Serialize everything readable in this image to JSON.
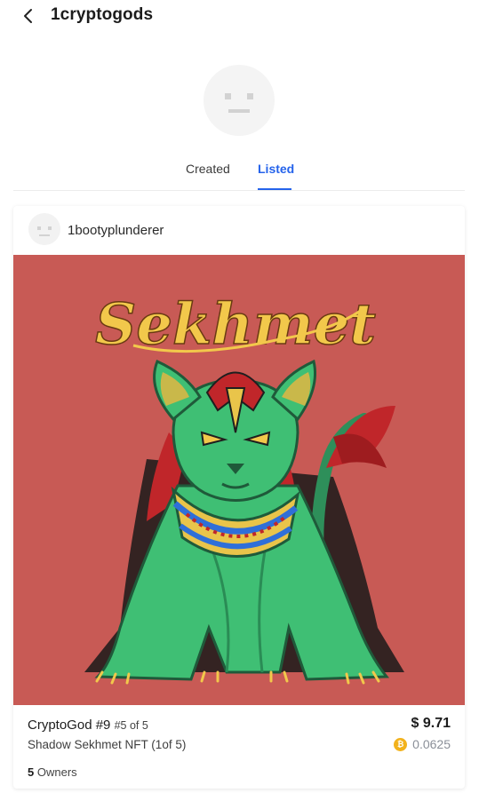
{
  "header": {
    "title": "1cryptogods",
    "back_icon": "chevron-left-icon"
  },
  "tabs": [
    {
      "label": "Created",
      "active": false
    },
    {
      "label": "Listed",
      "active": true
    }
  ],
  "card": {
    "owner_name": "1bootyplunderer",
    "artwork": {
      "logo_text": "Sekhmet",
      "background_color": "#c85a55"
    },
    "nft_name": "CryptoGod #9",
    "edition": "#5 of 5",
    "description": "Shadow Sekhmet NFT (1of 5)",
    "owners_count": "5",
    "owners_label": "Owners",
    "price_usd": "$ 9.71",
    "price_crypto": "0.0625",
    "coin_icon": "bitcoin-icon"
  },
  "colors": {
    "accent": "#2563eb",
    "coin": "#f2b21c"
  }
}
